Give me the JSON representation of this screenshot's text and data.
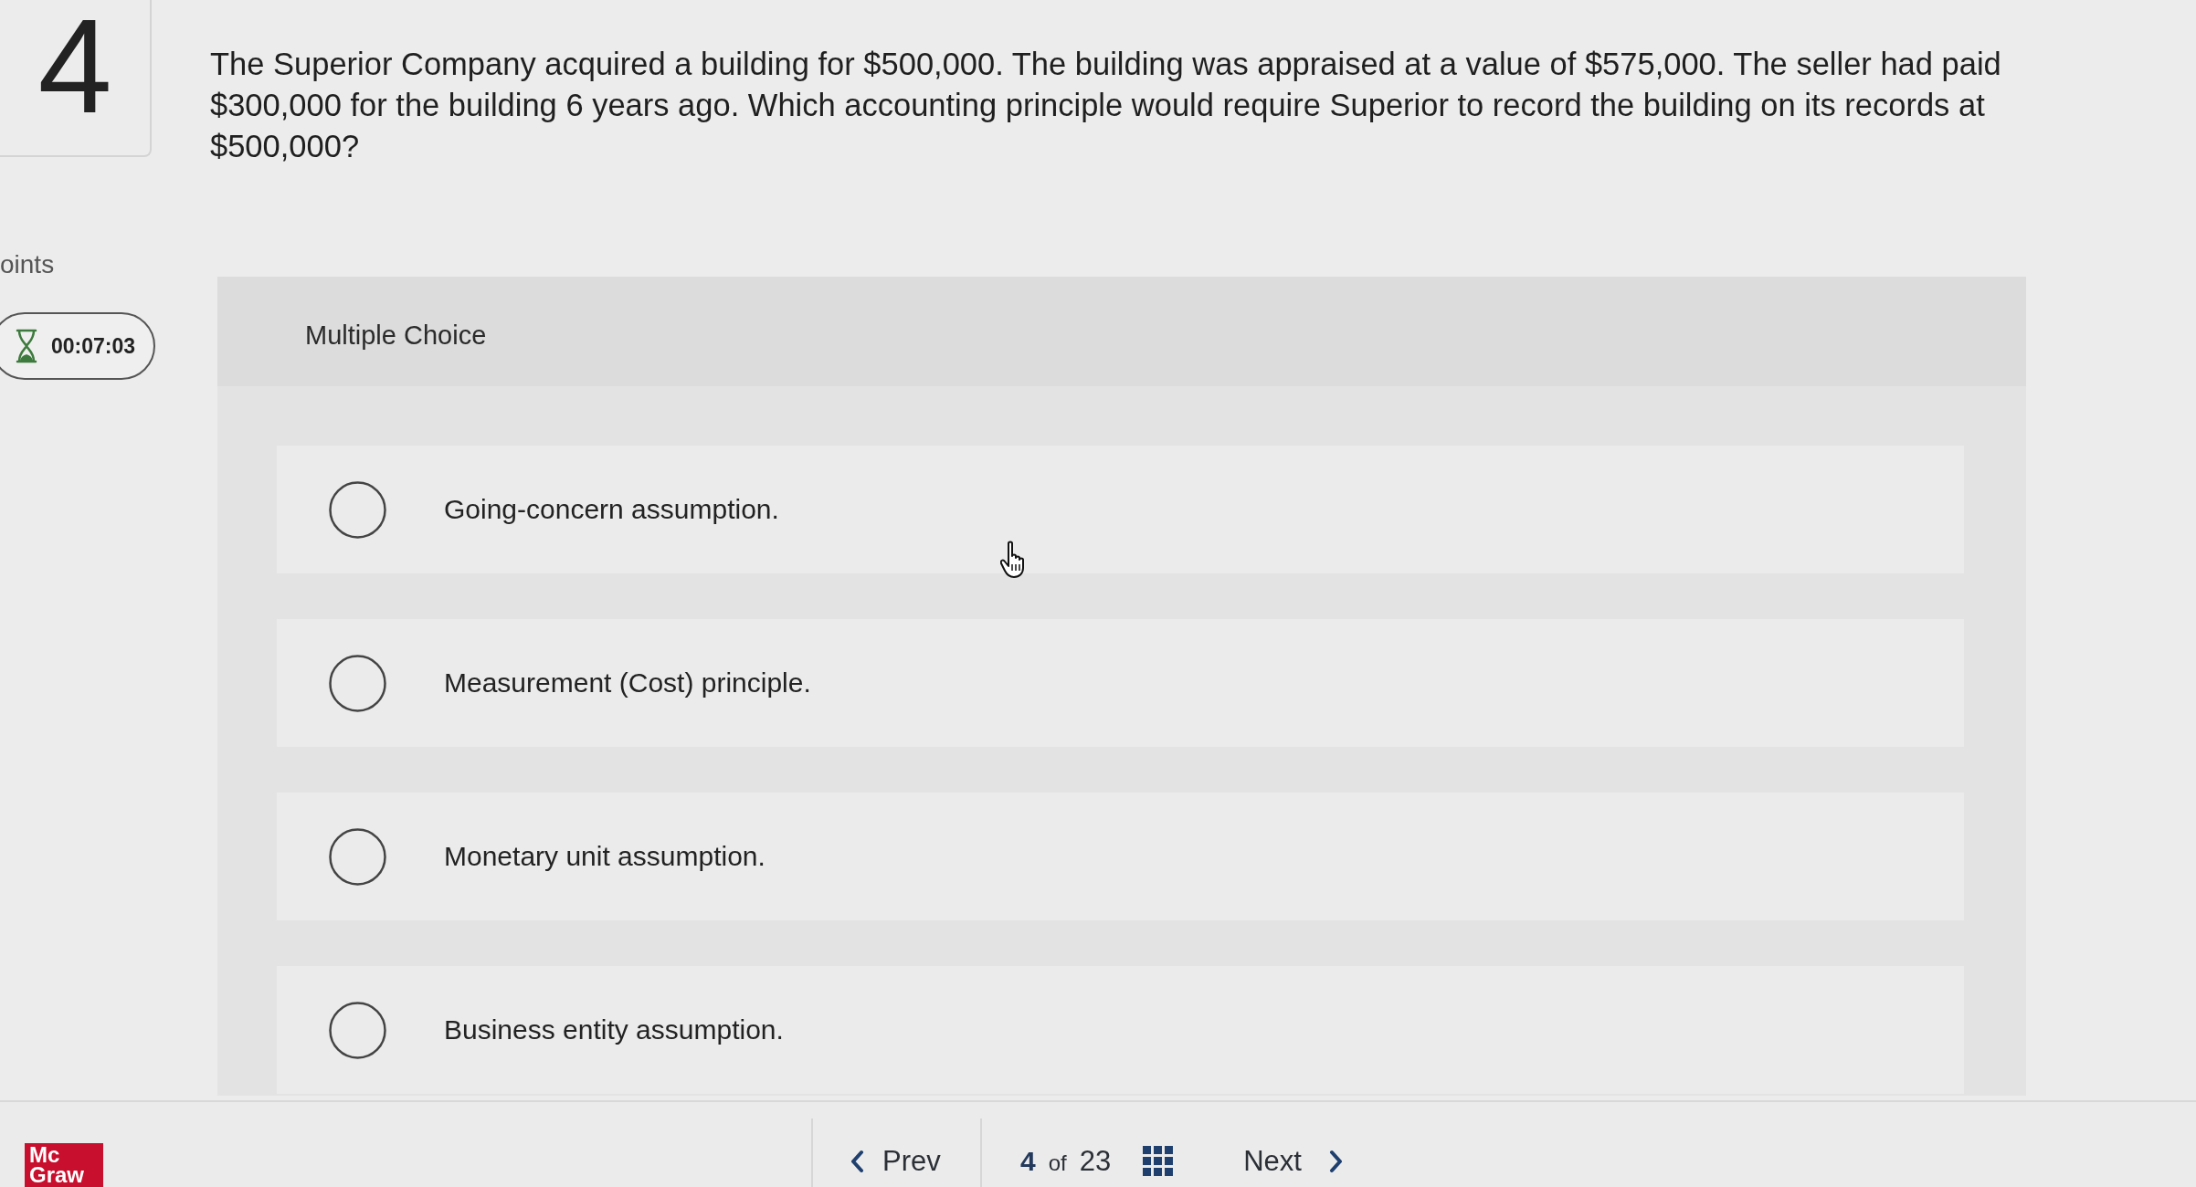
{
  "question": {
    "number": "4",
    "points_label": "oints",
    "timer": "00:07:03",
    "text": "The Superior Company acquired a building for $500,000. The building was appraised at a value of $575,000. The seller had paid $300,000 for the building 6 years ago. Which accounting principle would require Superior to record the building on its records at $500,000?"
  },
  "multiple_choice": {
    "heading": "Multiple Choice",
    "options": [
      {
        "label": "Going-concern assumption.",
        "selected": false
      },
      {
        "label": "Measurement (Cost) principle.",
        "selected": false
      },
      {
        "label": "Monetary unit assumption.",
        "selected": false
      },
      {
        "label": "Business entity assumption.",
        "selected": false
      }
    ]
  },
  "footer": {
    "logo": [
      "Mc",
      "Graw"
    ],
    "prev": "Prev",
    "position": {
      "current": "4",
      "of": "of",
      "total": "23"
    },
    "next": "Next"
  }
}
